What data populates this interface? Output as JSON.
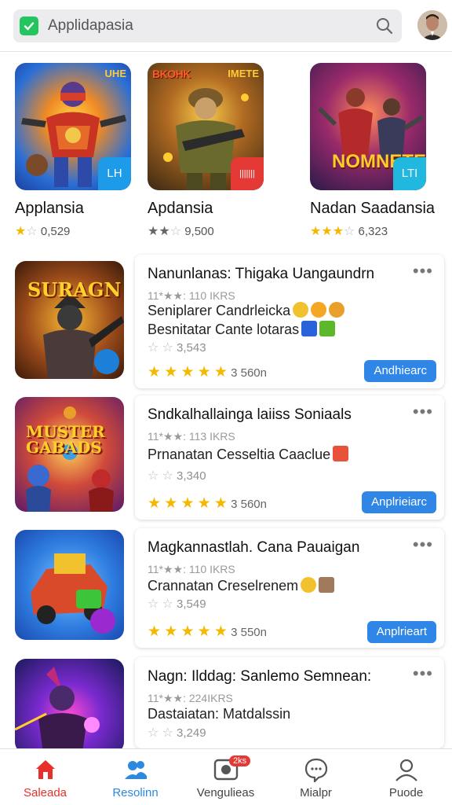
{
  "search": {
    "placeholder_text": "Applidapasia"
  },
  "featured": [
    {
      "title": "Applansia",
      "rating": "0,529",
      "stars": [
        "on",
        "off",
        "off",
        "off",
        "off"
      ],
      "badge": "LH",
      "badge_color": "#1e9be8",
      "caption_left": "",
      "caption_right": "UHE"
    },
    {
      "title": "Apdansia",
      "rating": "9,500",
      "stars": [
        "dark",
        "dark",
        "off",
        "off",
        "off"
      ],
      "badge": "|||||||",
      "badge_color": "#e53935",
      "caption_left": "BKOHK",
      "caption_right": "IMETE"
    },
    {
      "title": "Nadan Saadansia",
      "rating": "6,323",
      "stars": [
        "on",
        "on",
        "on",
        "off",
        "off"
      ],
      "badge": "LTI",
      "badge_color": "#21b8e0",
      "caption_left": "",
      "caption_right": "",
      "caption_bottom": "NOMNETE"
    }
  ],
  "rows": [
    {
      "title": "Nanunlanas: Thigaka Uangaundrn",
      "meta": "11*★★: 110 IKRS",
      "lines": [
        "Seniplarer Candrleicka",
        "Besnitatar Cante lotaras"
      ],
      "sub_rating": "3,543",
      "score": "3 560n",
      "button": "Andhiearc",
      "thumb_caption": "SURAGN"
    },
    {
      "title": "Sndkalhallainga laiiss Soniaals",
      "meta": "11*★★: 113 IKRS",
      "lines": [
        "Prnanatan Cesseltia Caaclue"
      ],
      "sub_rating": "3,340",
      "score": "3 560n",
      "button": "Anplrieiarc",
      "thumb_caption": "MUSTER GABADS"
    },
    {
      "title": "Magkannastlah. Cana Pauaigan",
      "meta": "11*★★: 110 IKRS",
      "lines": [
        "Crannatan Creselrenem"
      ],
      "sub_rating": "3,549",
      "score": "3 550n",
      "button": "Anplrieart",
      "thumb_caption": ""
    },
    {
      "title": "Nagn: Ilddag: Sanlemo Semnean:",
      "meta": "11*★★: 224IKRS",
      "lines": [
        "Dastaiatan: Matdalssin"
      ],
      "sub_rating": "3,249",
      "score": "",
      "button": "",
      "thumb_caption": ""
    }
  ],
  "nav": [
    {
      "label": "Saleada",
      "icon": "home-icon"
    },
    {
      "label": "Resolinn",
      "icon": "people-icon"
    },
    {
      "label": "Vengulieas",
      "icon": "record-icon",
      "badge": "2ks"
    },
    {
      "label": "Mialpr",
      "icon": "chat-icon"
    },
    {
      "label": "Puode",
      "icon": "profile-icon"
    }
  ],
  "colors": {
    "accent": "#2f86e6",
    "active_nav": "#e8302b",
    "star": "#f5b800"
  }
}
